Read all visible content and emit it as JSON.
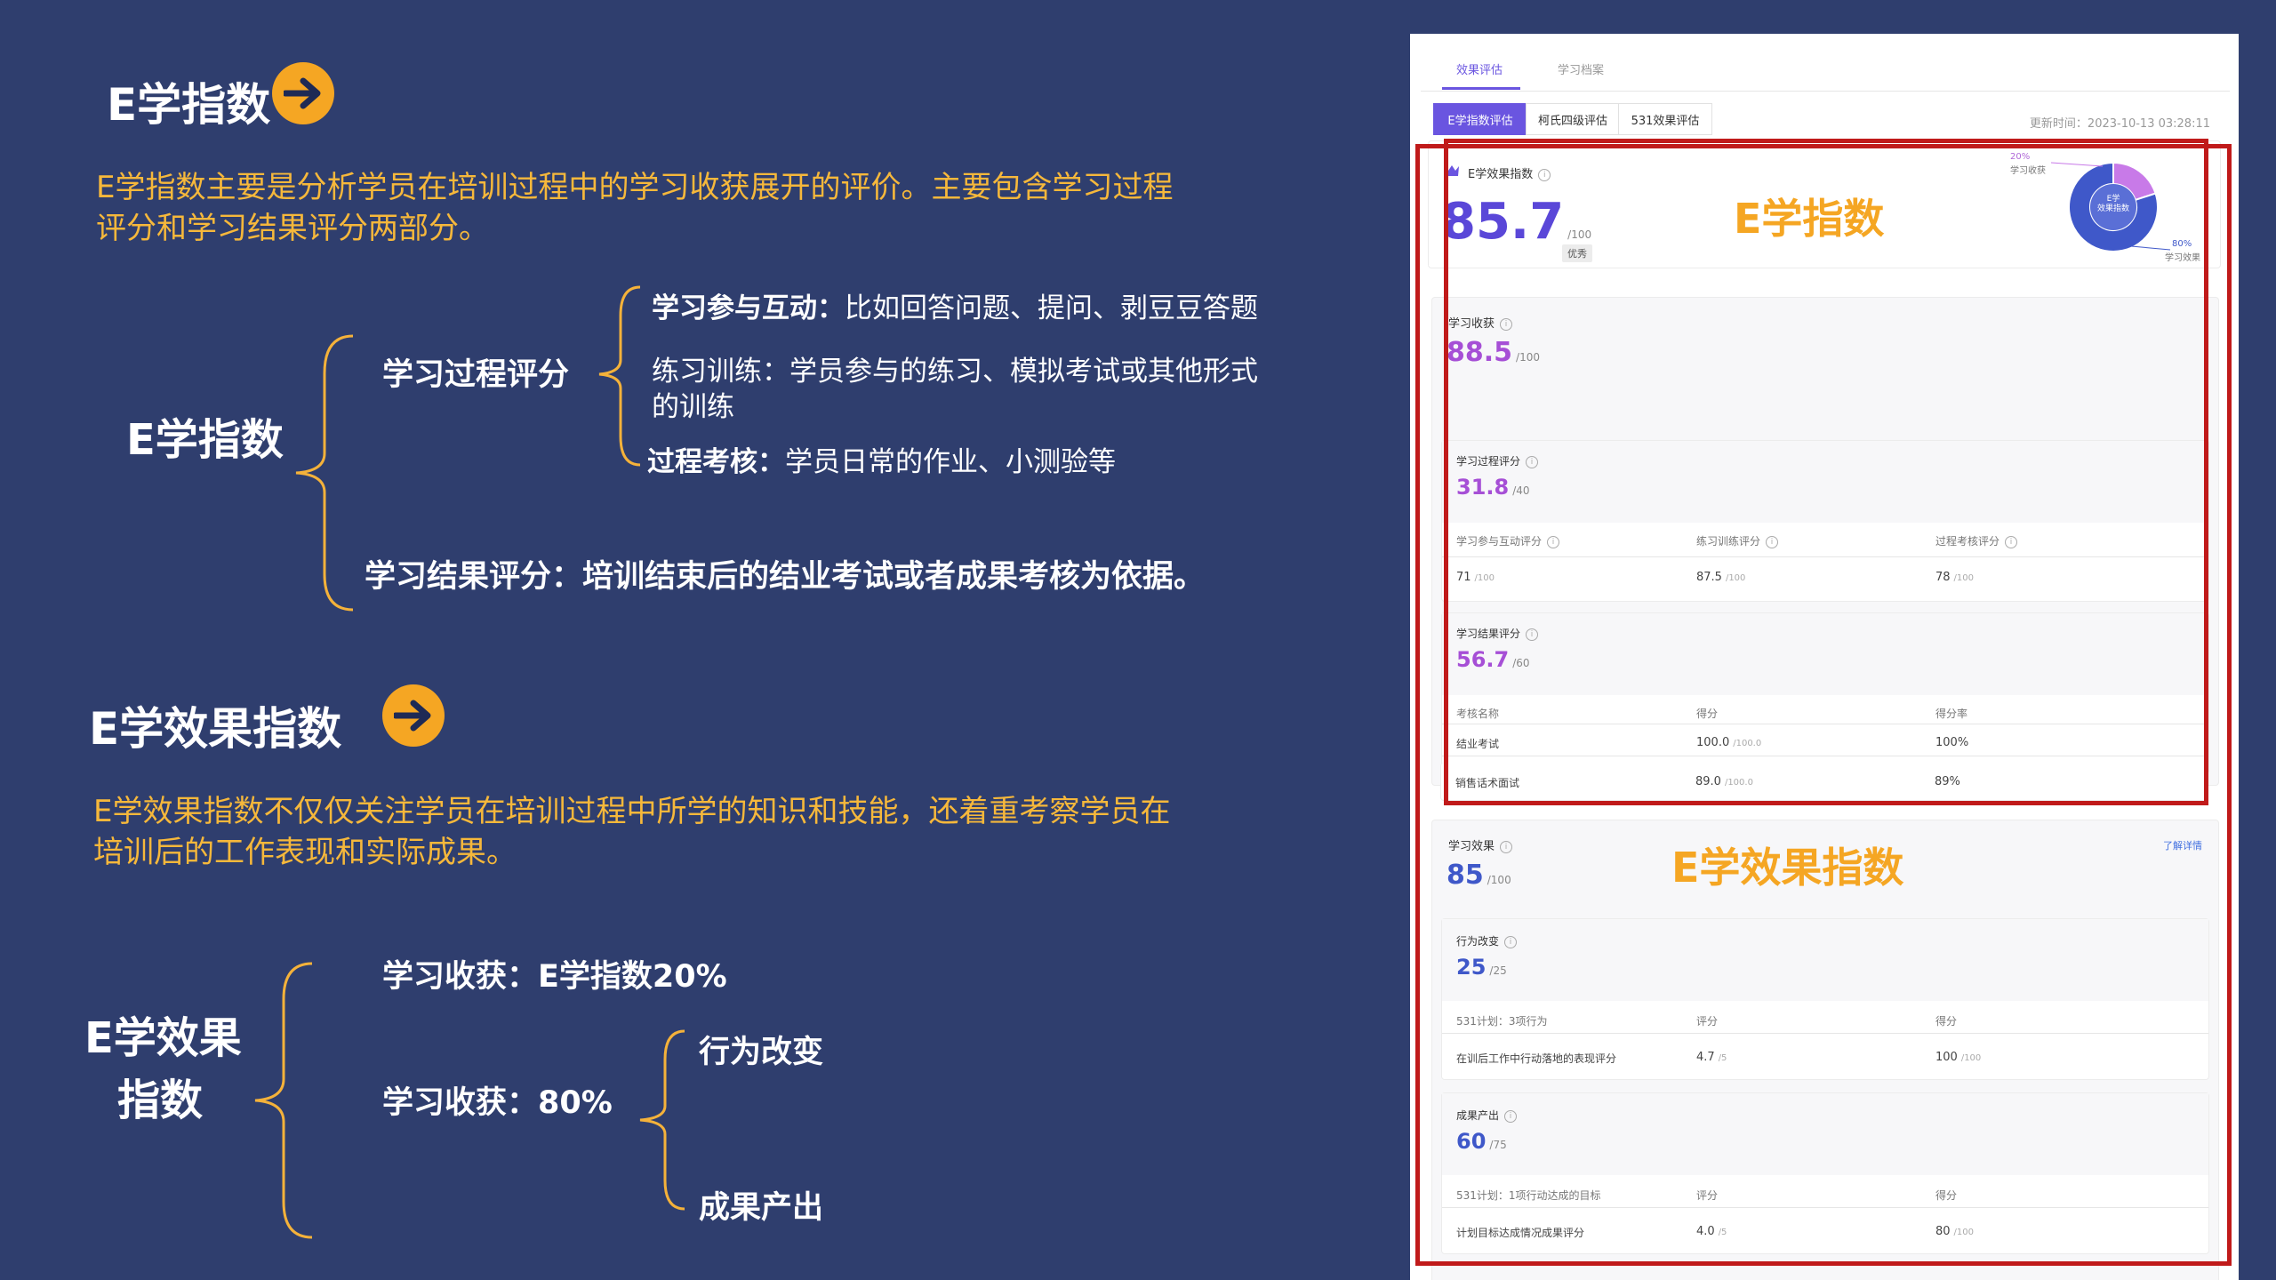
{
  "slide": {
    "section1": {
      "title": "E学指数",
      "description": "E学指数主要是分析学员在培训过程中的学习收获展开的评价。主要包含学习过程评分和学习结果评分两部分。",
      "tree_root": "E学指数",
      "process": {
        "label": "学习过程评分",
        "item1_key": "学习参与互动：",
        "item1_val": "比如回答问题、提问、剥豆豆答题",
        "item2": "练习训练：学员参与的练习、模拟考试或其他形式的训练",
        "item3_key": "过程考核：",
        "item3_val": "学员日常的作业、小测验等"
      },
      "result": "学习结果评分：培训结束后的结业考试或者成果考核为依据。"
    },
    "section2": {
      "title": "E学效果指数",
      "description": "E学效果指数不仅仅关注学员在培训过程中所学的知识和技能，还着重考察学员在培训后的工作表现和实际成果。",
      "tree_root_line1": "E学效果",
      "tree_root_line2": "指数",
      "branch1": "学习收获：E学指数20%",
      "branch2": "学习收获：80%",
      "leaf1": "行为改变",
      "leaf2": "成果产出"
    }
  },
  "app": {
    "tabs": [
      "效果评估",
      "学习档案"
    ],
    "segments": [
      "E学指数评估",
      "柯氏四级评估",
      "531效果评估"
    ],
    "updated": "更新时间：2023-10-13 03:28:11",
    "index": {
      "title": "E学效果指数",
      "score": "85.7",
      "den": "/100",
      "badge": "优秀",
      "donut_center": "E学\n效果指数",
      "donut_label_top_pct": "20%",
      "donut_label_top": "学习收获",
      "donut_label_bottom_pct": "80%",
      "donut_label_bottom": "学习效果",
      "donut_share_harvest": 0.2,
      "donut_share_effect": 0.8
    },
    "harvest": {
      "title": "学习收获",
      "score": "88.5",
      "den": "/100",
      "process": {
        "title": "学习过程评分",
        "score": "31.8",
        "den": "/40",
        "cols": [
          {
            "name": "学习参与互动评分",
            "value": "71",
            "den": "/100"
          },
          {
            "name": "练习训练评分",
            "value": "87.5",
            "den": "/100"
          },
          {
            "name": "过程考核评分",
            "value": "78",
            "den": "/100"
          }
        ]
      },
      "result": {
        "title": "学习结果评分",
        "score": "56.7",
        "den": "/60",
        "headers": [
          "考核名称",
          "得分",
          "得分率"
        ],
        "rows": [
          {
            "name": "结业考试",
            "score": "100.0",
            "den": "/100.0",
            "rate": "100%"
          },
          {
            "name": "销售话术面试",
            "score": "89.0",
            "den": "/100.0",
            "rate": "89%"
          }
        ]
      }
    },
    "effect": {
      "title": "学习效果",
      "score": "85",
      "den": "/100",
      "link": "了解详情",
      "behavior": {
        "title": "行为改变",
        "score": "25",
        "den": "/25",
        "headers": [
          "531计划：3项行为",
          "评分",
          "得分"
        ],
        "row": {
          "name": "在训后工作中行动落地的表现评分",
          "rating": "4.7",
          "rating_den": "/5",
          "score": "100",
          "score_den": "/100"
        }
      },
      "output": {
        "title": "成果产出",
        "score": "60",
        "den": "/75",
        "headers": [
          "531计划：1项行动达成的目标",
          "评分",
          "得分"
        ],
        "row": {
          "name": "计划目标达成情况成果评分",
          "rating": "4.0",
          "rating_den": "/5",
          "score": "80",
          "score_den": "/100"
        }
      }
    },
    "overlay_label1": "E学指数",
    "overlay_label2": "E学效果指数"
  },
  "colors": {
    "background": "#2f3e6e",
    "accent_orange": "#f5a623",
    "text_yellow": "#f6b83b",
    "purple": "#6a55e0",
    "magenta": "#a64fd6",
    "blue": "#3f58c9",
    "red_frame": "#c01a1a"
  }
}
